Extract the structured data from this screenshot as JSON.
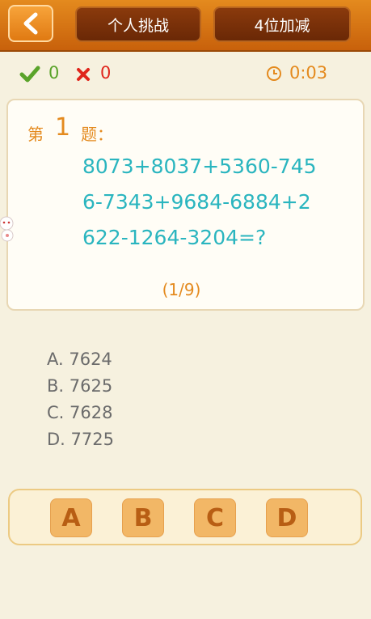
{
  "header": {
    "mode_tab": "个人挑战",
    "level_tab": "4位加减"
  },
  "score": {
    "correct": "0",
    "wrong": "0",
    "timer": "0:03"
  },
  "question": {
    "prefix": "第",
    "number": "1",
    "suffix": "题：",
    "text": "8073+8037+5360-7456-7343+9684-6884+2622-1264-3204=?",
    "progress": "(1/9)"
  },
  "options": [
    "A. 7624",
    "B. 7625",
    "C. 7628",
    "D. 7725"
  ],
  "answers": [
    "A",
    "B",
    "C",
    "D"
  ],
  "colors": {
    "header": "#d4721a",
    "accent": "#e48a1e",
    "question_text": "#2ab5bf",
    "correct": "#5aa32a",
    "wrong": "#e0261c",
    "answer_button": "#f2b766"
  },
  "icons": {
    "back": "chevron-left-icon",
    "correct": "check-icon",
    "wrong": "x-icon",
    "timer": "clock-icon"
  }
}
